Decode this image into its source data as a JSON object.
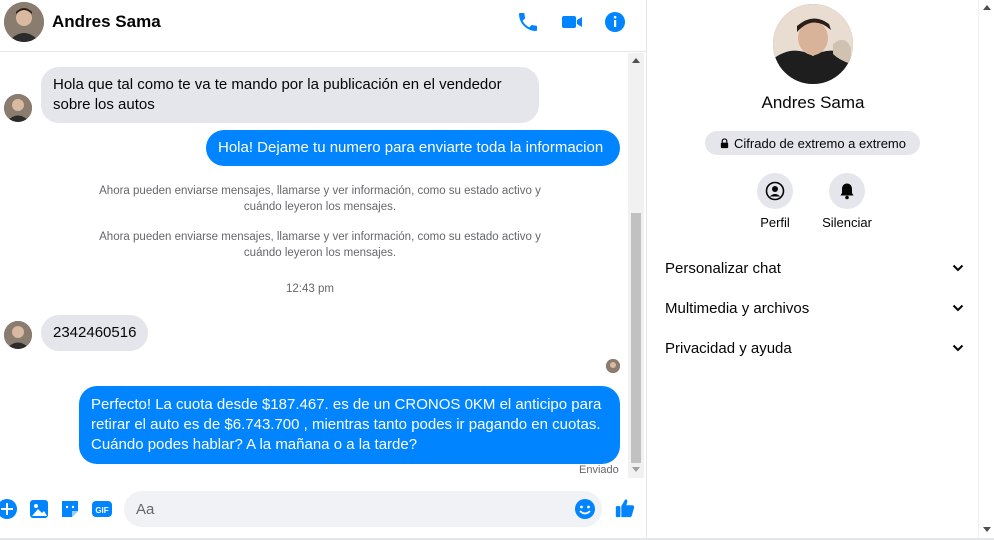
{
  "contact": {
    "name": "Andres Sama"
  },
  "header": {
    "call_icon": "phone-icon",
    "video_icon": "video-camera-icon",
    "info_icon": "info-icon"
  },
  "messages": {
    "m1": "Hola que tal como te va te mando por la publicación en el vendedor sobre los autos",
    "m2": "Hola! Dejame tu numero  para enviarte toda la informacion",
    "sys1": "Ahora pueden enviarse mensajes, llamarse y ver información, como su estado activo y cuándo leyeron los mensajes.",
    "sys2": "Ahora pueden enviarse mensajes, llamarse y ver información, como su estado activo y cuándo leyeron los mensajes.",
    "time": "12:43 pm",
    "m3": "2342460516",
    "m4": "Perfecto! La cuota desde $187.467. es de un CRONOS 0KM el anticipo para retirar el auto es de $6.743.700 , mientras tanto podes ir pagando en cuotas. Cuándo podes hablar? A la mañana o a la tarde?",
    "status": "Enviado"
  },
  "composer": {
    "placeholder": "Aa",
    "icons": [
      "plus-icon",
      "gallery-icon",
      "sticker-icon",
      "gif-icon",
      "emoji-icon",
      "like-icon"
    ],
    "gif_label": "GIF"
  },
  "info_panel": {
    "encryption": "Cifrado de extremo a extremo",
    "actions": [
      {
        "label": "Perfil",
        "icon": "profile-icon"
      },
      {
        "label": "Silenciar",
        "icon": "bell-icon"
      }
    ],
    "sections": [
      {
        "label": "Personalizar chat"
      },
      {
        "label": "Multimedia y archivos"
      },
      {
        "label": "Privacidad y ayuda"
      }
    ]
  },
  "colors": {
    "accent": "#0084ff",
    "incoming": "#e4e6eb",
    "muted": "#65676b"
  }
}
